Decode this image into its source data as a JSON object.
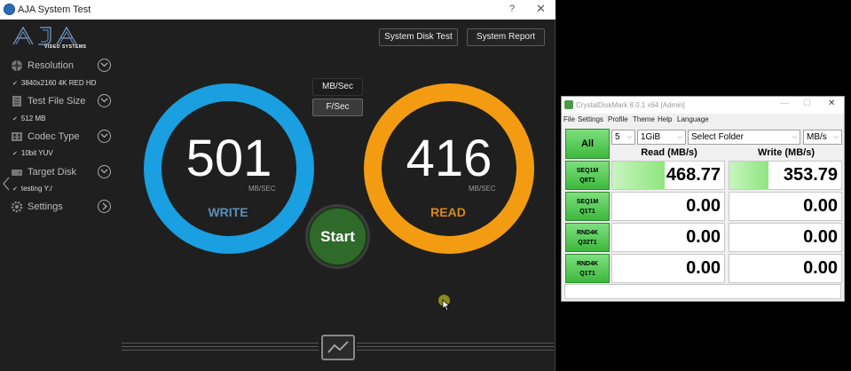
{
  "aja": {
    "title": "AJA System Test",
    "title_controls": {
      "help": "?",
      "close": "✕"
    },
    "logo": {
      "text": "AJA",
      "subtitle": "VIDEO SYSTEMS"
    },
    "buttons": {
      "system_disk_test": "System Disk Test",
      "system_report": "System Report"
    },
    "sidebar": {
      "resolution": {
        "label": "Resolution",
        "value": "3840x2160 4K RED HD"
      },
      "test_file_size": {
        "label": "Test File Size",
        "value": "512 MB"
      },
      "codec_type": {
        "label": "Codec Type",
        "value": "10bit YUV"
      },
      "target_disk": {
        "label": "Target Disk",
        "value": "testing Y:/"
      },
      "settings": {
        "label": "Settings"
      }
    },
    "units": {
      "mb_sec": "MB/Sec",
      "f_sec": "F/Sec"
    },
    "write": {
      "value": "501",
      "unit": "MB/SEC",
      "label": "WRITE",
      "color": "#1a9fe0"
    },
    "read": {
      "value": "416",
      "unit": "MB/SEC",
      "label": "READ",
      "color": "#f39c12"
    },
    "start_label": "Start"
  },
  "cdm": {
    "title": "CrystalDiskMark 8.0.1 x64 [Admin]",
    "menu": [
      "File",
      "Settings",
      "Profile",
      "Theme",
      "Help",
      "Language"
    ],
    "all_label": "All",
    "count": "5",
    "size": "1GiB",
    "folder": "Select Folder",
    "unit": "MB/s",
    "headers": {
      "read": "Read (MB/s)",
      "write": "Write (MB/s)"
    },
    "rows": [
      {
        "l1": "SEQ1M",
        "l2": "Q8T1",
        "read": "468.77",
        "write": "353.79",
        "read_fill": 0.47,
        "write_fill": 0.35
      },
      {
        "l1": "SEQ1M",
        "l2": "Q1T1",
        "read": "0.00",
        "write": "0.00",
        "read_fill": 0,
        "write_fill": 0
      },
      {
        "l1": "RND4K",
        "l2": "Q32T1",
        "read": "0.00",
        "write": "0.00",
        "read_fill": 0,
        "write_fill": 0
      },
      {
        "l1": "RND4K",
        "l2": "Q1T1",
        "read": "0.00",
        "write": "0.00",
        "read_fill": 0,
        "write_fill": 0
      }
    ]
  }
}
